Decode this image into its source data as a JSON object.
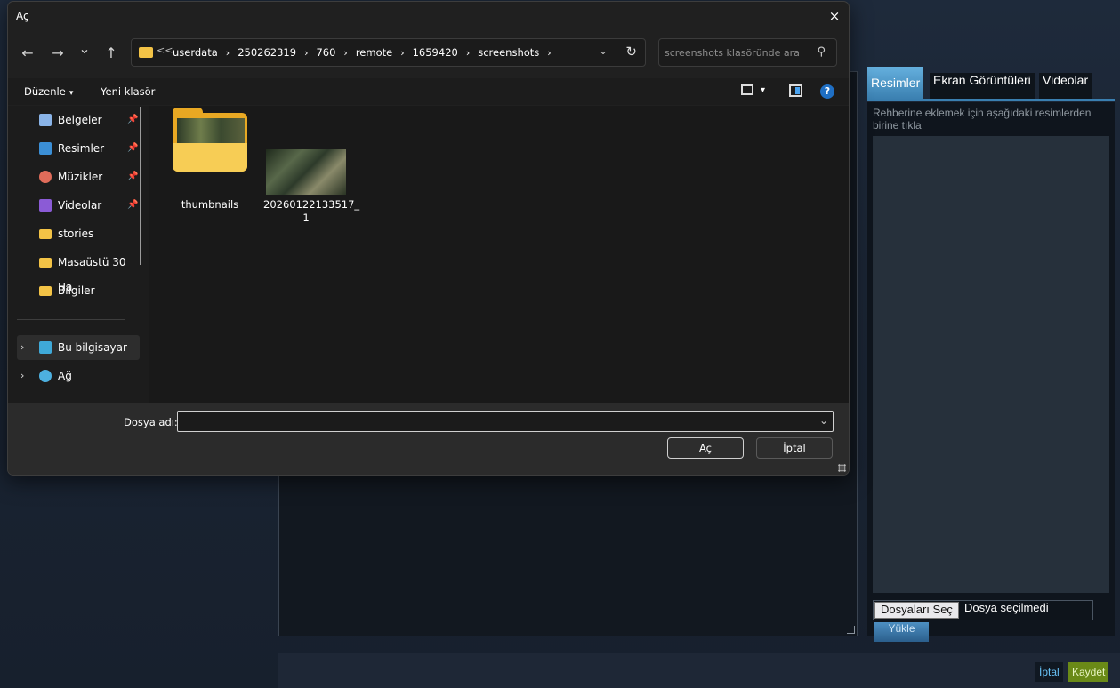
{
  "dialog": {
    "title": "Aç",
    "close_icon": "×",
    "nav": {
      "back_icon": "←",
      "forward_icon": "→",
      "history_icon": "⌄",
      "up_icon": "↑"
    },
    "address": {
      "overflow": "<<",
      "crumbs": [
        "userdata",
        "250262319",
        "760",
        "remote",
        "1659420",
        "screenshots"
      ],
      "separator": "›",
      "chevron_icon": "⌄",
      "refresh_icon": "↻"
    },
    "search": {
      "placeholder": "screenshots klasöründe ara",
      "icon": "⚲"
    },
    "commandbar": {
      "organize": "Düzenle",
      "organize_caret": "▾",
      "new_folder": "Yeni klasör",
      "view_caret": "▾",
      "help": "?"
    },
    "sidebar": {
      "items": [
        {
          "label": "Belgeler",
          "pinned": true,
          "color": "#8ab4e8"
        },
        {
          "label": "Resimler",
          "pinned": true,
          "color": "#3b8fd6"
        },
        {
          "label": "Müzikler",
          "pinned": true,
          "color": "#e06c5a"
        },
        {
          "label": "Videolar",
          "pinned": true,
          "color": "#8b5bd6"
        },
        {
          "label": "stories",
          "pinned": false,
          "color": "#f3c346"
        },
        {
          "label": "Masaüstü 30 Ha",
          "pinned": false,
          "color": "#f3c346"
        },
        {
          "label": "Bilgiler",
          "pinned": false,
          "color": "#f3c346"
        }
      ],
      "pin_icon": "📌",
      "expand_icon": "›",
      "this_pc": "Bu bilgisayar",
      "network": "Ağ"
    },
    "files": [
      {
        "name": "thumbnails",
        "kind": "folder"
      },
      {
        "name_line1": "20260122133517_",
        "name_line2": "1",
        "kind": "image"
      }
    ],
    "footer": {
      "filename_label": "Dosya adı:",
      "filename_value": "",
      "chevron_icon": "⌄",
      "open_button": "Aç",
      "cancel_button": "İptal"
    }
  },
  "page": {
    "tabs": [
      "Resimler",
      "Ekran Görüntüleri",
      "Videolar"
    ],
    "active_tab": "Resimler",
    "hint": "Rehberine eklemek için aşağıdaki resimlerden birine tıkla",
    "choose_files": "Dosyaları Seç",
    "no_file": "Dosya seçilmedi",
    "upload": "Yükle",
    "cancel": "İptal",
    "save": "Kaydet",
    "accent": "#3a7fb0",
    "save_color": "#6a8a17"
  }
}
